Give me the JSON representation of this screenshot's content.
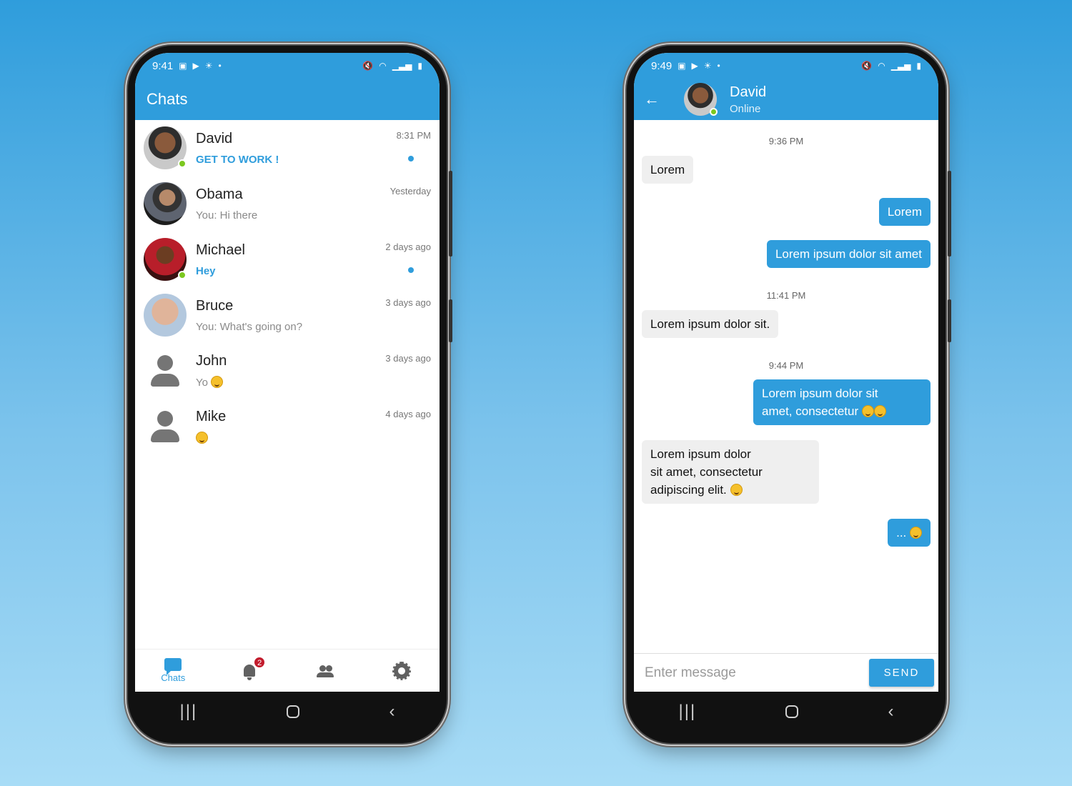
{
  "colors": {
    "accent": "#2f9ddc",
    "online": "#7cc820",
    "badge": "#c21b2c"
  },
  "left_phone": {
    "status_time": "9:41",
    "title": "Chats",
    "chats": [
      {
        "name": "David",
        "message": "GET TO WORK !",
        "time": "8:31 PM",
        "unread": true,
        "online": true
      },
      {
        "name": "Obama",
        "message": "You: Hi there",
        "time": "Yesterday",
        "unread": false,
        "online": false
      },
      {
        "name": "Michael",
        "message": "Hey",
        "time": "2 days ago",
        "unread": true,
        "online": true
      },
      {
        "name": "Bruce",
        "message": "You: What's going on?",
        "time": "3 days ago",
        "unread": false,
        "online": false
      },
      {
        "name": "John",
        "message": "Yo",
        "time": "3 days ago",
        "unread": false,
        "online": false
      },
      {
        "name": "Mike",
        "message": "",
        "time": "4 days ago",
        "unread": false,
        "online": false
      }
    ],
    "nav": {
      "chats_label": "Chats",
      "notification_count": "2"
    }
  },
  "right_phone": {
    "status_time": "9:49",
    "contact_name": "David",
    "contact_status": "Online",
    "stamps": [
      "9:36 PM",
      "11:41 PM",
      "9:44 PM"
    ],
    "messages": [
      "Lorem",
      "Lorem",
      "Lorem ipsum dolor sit amet",
      "Lorem ipsum dolor sit.",
      "Lorem ipsum dolor sit",
      "amet, consectetur",
      "Lorem ipsum dolor",
      "sit amet, consectetur",
      "adipiscing elit.",
      "..."
    ],
    "composer": {
      "placeholder": "Enter message",
      "send_label": "SEND"
    }
  }
}
